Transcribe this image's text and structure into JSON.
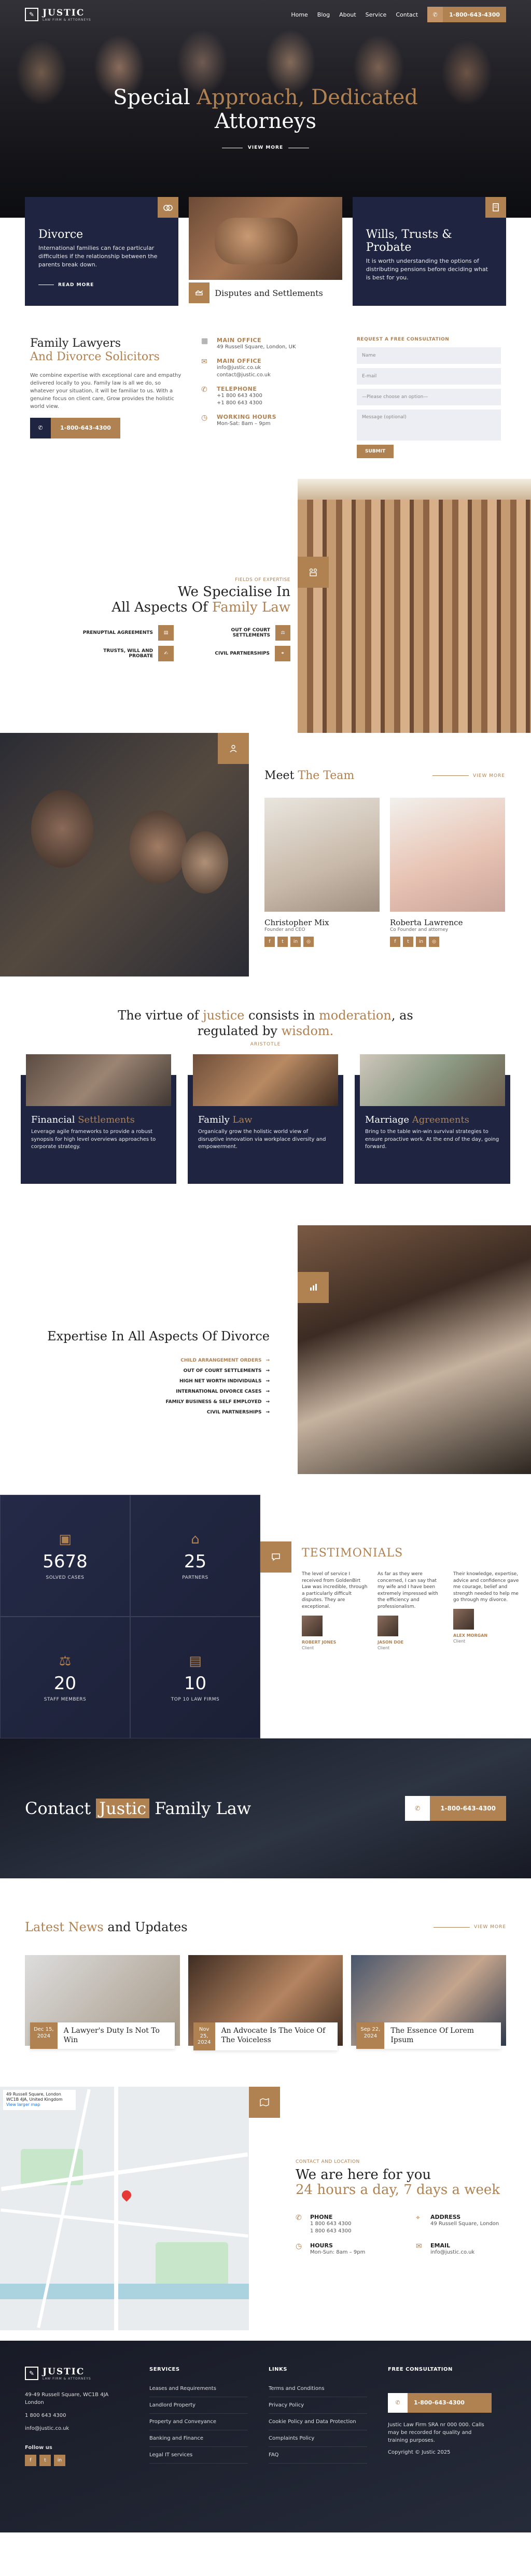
{
  "header": {
    "logo": "JUSTIC",
    "logo_sub": "LAW FIRM & ATTORNEYS",
    "nav": [
      "Home",
      "Blog",
      "About",
      "Service",
      "Contact"
    ],
    "phone": "1-800-643-4300"
  },
  "hero": {
    "title_a": "Special ",
    "title_b": "Approach, Dedicated",
    "title_c": "Attorneys",
    "cta": "VIEW MORE"
  },
  "pillars": {
    "divorce": {
      "title": "Divorce",
      "text": "International families can face particular difficulties if the relationship between the parents break down.",
      "link": "READ MORE"
    },
    "disputes": {
      "title": "Disputes and Settlements"
    },
    "wills": {
      "title": "Wills, Trusts & Probate",
      "text": "It is worth understanding the options of distributing pensions before deciding what is best for you."
    }
  },
  "intro": {
    "title_a": "Family Lawyers",
    "title_b": "And Divorce Solicitors",
    "text": "We combine expertise with exceptional care and empathy delivered locally to you. Family law is all we do, so whatever your situation, it will be familiar to us. With a genuine focus on client care, Grow provides the holistic world view.",
    "phone": "1-800-643-4300",
    "office_label": "MAIN OFFICE",
    "office_addr": "49 Russell Square, London, UK",
    "office2_label": "MAIN OFFICE",
    "office2_lines": "info@justic.co.uk\ncontact@justic.co.uk",
    "tel_label": "TELEPHONE",
    "tel_lines": "+1 800 643 4300\n+1 800 643 4300",
    "hours_label": "WORKING HOURS",
    "hours": "Mon-Sat: 8am – 9pm",
    "form_title": "REQUEST A FREE CONSULTATION",
    "f_name": "Name",
    "f_email": "E-mail",
    "f_select": "—Please choose an option—",
    "f_msg": "Message (optional)",
    "f_submit": "SUBMIT"
  },
  "spec": {
    "kicker": "FIELDS OF EXPERTISE",
    "title_a": "We Specialise In",
    "title_b": "All Aspects Of ",
    "title_c": "Family Law",
    "items": [
      "PRENUPTIAL AGREEMENTS",
      "OUT OF COURT SETTLEMENTS",
      "TRUSTS, WILL AND PROBATE",
      "CIVIL PARTNERSHIPS"
    ]
  },
  "team": {
    "title_a": "Meet ",
    "title_b": "The Team",
    "view": "VIEW MORE",
    "members": [
      {
        "name": "Christopher Mix",
        "role": "Founder and CEO"
      },
      {
        "name": "Roberta Lawrence",
        "role": "Co Founder and attorney"
      }
    ]
  },
  "quote": {
    "a": "The virtue of ",
    "b": "justice",
    "c": " consists in ",
    "d": "moderation",
    "e": ", as",
    "f": "regulated by ",
    "g": "wisdom.",
    "by": "ARISTOTLE"
  },
  "services": [
    {
      "t1": "Financial ",
      "t2": "Settlements",
      "text": "Leverage agile frameworks to provide a robust synopsis for high level overviews approaches to corporate strategy."
    },
    {
      "t1": "Family ",
      "t2": "Law",
      "text": "Organically grow the holistic world view of disruptive innovation via workplace diversity and empowerment."
    },
    {
      "t1": "Marriage ",
      "t2": "Agreements",
      "text": "Bring to the table win-win survival strategies to ensure proactive work. At the end of the day, going forward."
    }
  ],
  "divorce": {
    "title": "Expertise In All Aspects Of Divorce",
    "items": [
      "CHILD ARRANGEMENT ORDERS",
      "OUT OF COURT SETTLEMENTS",
      "HIGH NET WORTH INDIVIDUALS",
      "INTERNATIONAL DIVORCE CASES",
      "FAMILY BUSINESS & SELF EMPLOYED",
      "CIVIL PARTNERSHIPS"
    ]
  },
  "stats": [
    {
      "n": "5678",
      "l": "SOLVED CASES"
    },
    {
      "n": "25",
      "l": "PARTNERS"
    },
    {
      "n": "20",
      "l": "STAFF MEMBERS"
    },
    {
      "n": "10",
      "l": "TOP 10 LAW FIRMS"
    }
  ],
  "testimonials": {
    "title": "TESTIMONIALS",
    "items": [
      {
        "text": "The level of service I received from GoldenBirt Law was incredible, through a particularly difficult disputes. They are exceptional.",
        "name": "ROBERT JONES",
        "role": "Client"
      },
      {
        "text": "As far as they were concerned, I can say that my wife and I have been extremely impressed with the efficiency and professionalism.",
        "name": "JASON DOE",
        "role": "Client"
      },
      {
        "text": "Their knowledge, expertise, advice and confidence gave me courage, belief and strength needed to help me go through my divorce.",
        "name": "ALEX MORGAN",
        "role": "Client"
      }
    ]
  },
  "contact": {
    "a": "Contact ",
    "b": "Justic",
    "c": " Family Law",
    "phone": "1-800-643-4300"
  },
  "news": {
    "title_a": "Latest News",
    "title_b": " and Updates",
    "view": "VIEW MORE",
    "items": [
      {
        "date": "Dec 15, 2024",
        "title": "A Lawyer's Duty Is Not To Win"
      },
      {
        "date": "Nov 25, 2024",
        "title": "An Advocate Is The Voice Of The Voiceless"
      },
      {
        "date": "Sep 22, 2024",
        "title": "The Essence Of Lorem Ipsum"
      }
    ]
  },
  "map": {
    "box": "49 Russell Square, London WC1B 4JA, United Kingdom",
    "link": "View larger map"
  },
  "reach": {
    "kicker": "CONTACT AND LOCATION",
    "title_a": "We are here for you",
    "title_b": "24 hours a day, 7 days a week",
    "phone_label": "PHONE",
    "phone": "1 800 643 4300\n1 800 643 4300",
    "addr_label": "ADDRESS",
    "addr": "49 Russell Square, London",
    "hours_label": "HOURS",
    "hours": "Mon-Sun: 8am – 9pm",
    "email_label": "EMAIL",
    "email": "info@justic.co.uk"
  },
  "footer": {
    "addr": "49-49 Russell Square, WC1B 4JA\nLondon",
    "phone": "1 800 643 4300",
    "email": "info@justic.co.uk",
    "follow": "Follow us",
    "services_title": "SERVICES",
    "services": [
      "Leases and Requirements",
      "Landlord Property",
      "Property and Conveyance",
      "Banking and Finance",
      "Legal IT services"
    ],
    "links_title": "LINKS",
    "links": [
      "Terms and Conditions",
      "Privacy Policy",
      "Cookie Policy and Data Protection",
      "Complaints Policy",
      "FAQ"
    ],
    "consult_title": "FREE CONSULTATION",
    "phone_btn": "1-800-643-4300",
    "legal": "Justic Law Firm SRA nr 000 000. Calls may be recorded for quality and training purposes.",
    "copy": "Copyright © Justic 2025"
  },
  "colors": {
    "gold": "#b08151",
    "navy": "#1f2541"
  }
}
